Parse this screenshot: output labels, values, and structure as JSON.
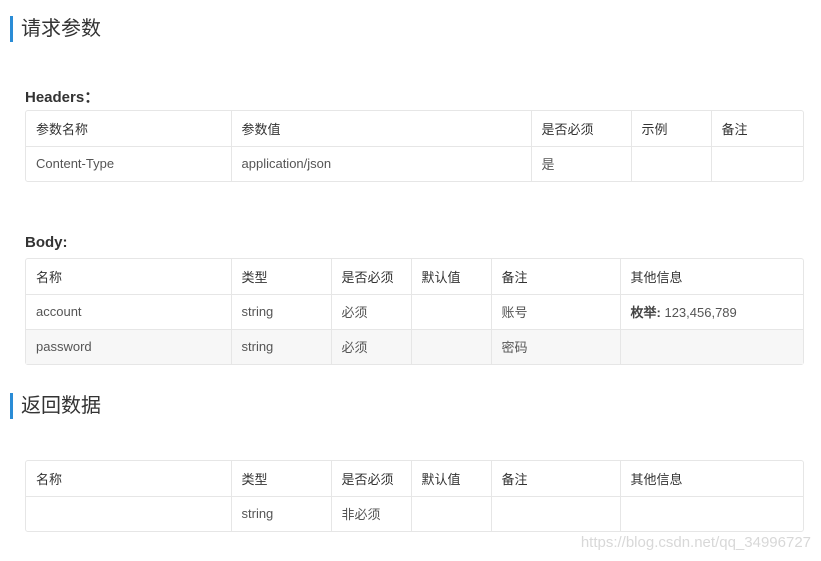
{
  "request": {
    "title": "请求参数",
    "headers": {
      "label": "Headers：",
      "columns": [
        "参数名称",
        "参数值",
        "是否必须",
        "示例",
        "备注"
      ],
      "rows": [
        [
          "Content-Type",
          "application/json",
          "是",
          "",
          ""
        ]
      ]
    },
    "body": {
      "label": "Body:",
      "columns": [
        "名称",
        "类型",
        "是否必须",
        "默认值",
        "备注",
        "其他信息"
      ],
      "rows": [
        [
          "account",
          "string",
          "必须",
          "",
          "账号",
          ""
        ],
        [
          "password",
          "string",
          "必须",
          "",
          "密码",
          ""
        ]
      ],
      "enum_label": "枚举:",
      "enum_values": "123,456,789"
    }
  },
  "response": {
    "title": "返回数据",
    "columns": [
      "名称",
      "类型",
      "是否必须",
      "默认值",
      "备注",
      "其他信息"
    ],
    "rows": [
      [
        "",
        "string",
        "非必须",
        "",
        "",
        ""
      ]
    ]
  },
  "watermark": "https://blog.csdn.net/qq_34996727",
  "colors": {
    "accent": "#2a8cd6",
    "border": "#e6e6e6",
    "stripe": "#f7f7f7"
  }
}
